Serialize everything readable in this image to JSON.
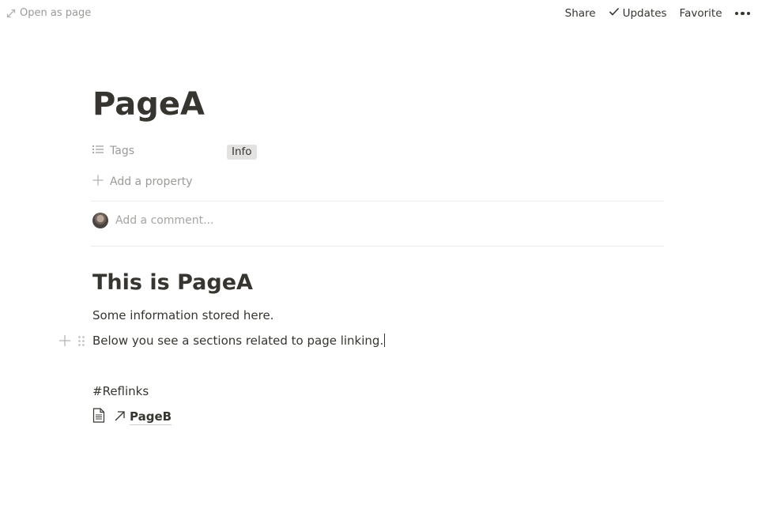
{
  "topbar": {
    "open_as_page": "Open as page",
    "share": "Share",
    "updates": "Updates",
    "favorite": "Favorite"
  },
  "page": {
    "title": "PageA",
    "properties": [
      {
        "label": "Tags",
        "value": "Info",
        "icon": "list-icon"
      }
    ],
    "add_property": "Add a property",
    "comment_placeholder": "Add a comment..."
  },
  "content": {
    "heading": "This is PageA",
    "paragraph1": "Some information stored here.",
    "paragraph2": "Below you see a sections related to page linking.",
    "reflinks_label": "#Reflinks",
    "link": {
      "label": "PageB",
      "icon": "document-icon",
      "arrow": "arrow-up-right-icon"
    }
  }
}
